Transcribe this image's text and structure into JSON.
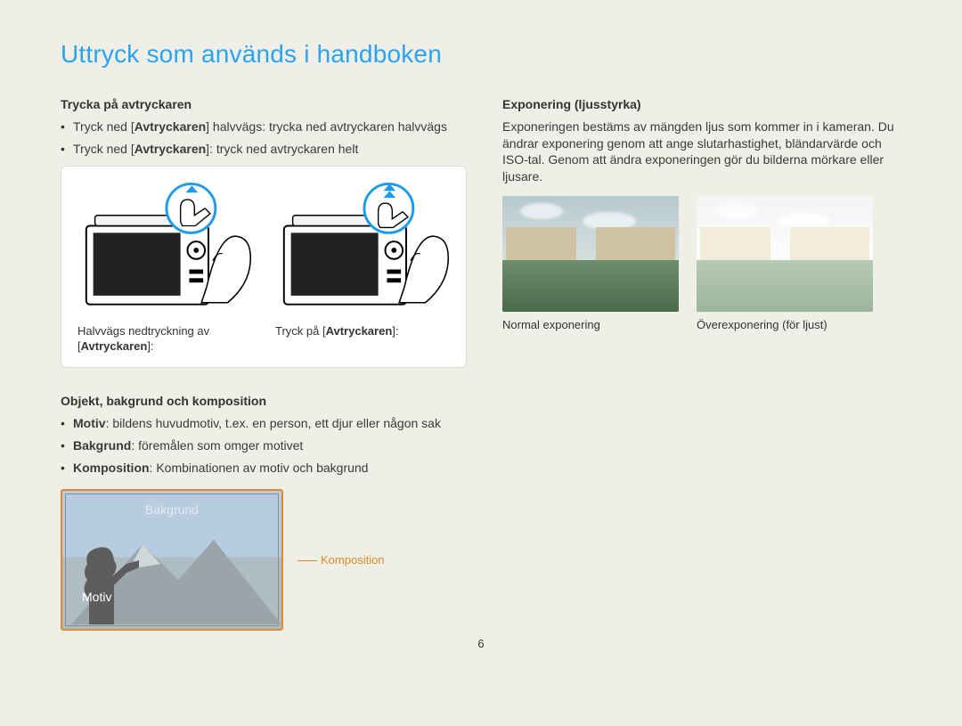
{
  "title": "Uttryck som används i handboken",
  "left": {
    "section1_heading": "Trycka på avtryckaren",
    "bullets1": [
      {
        "pre": "Tryck ned [",
        "strong": "Avtryckaren",
        "post": "] halvvägs: trycka ned avtryckaren halvvägs"
      },
      {
        "pre": "Tryck ned [",
        "strong": "Avtryckaren",
        "post": "]: tryck ned avtryckaren helt"
      }
    ],
    "fig_captions": {
      "left_pre": "Halvvägs nedtryckning av [",
      "left_strong": "Avtryckaren",
      "left_post": "]:",
      "right_pre": "Tryck på [",
      "right_strong": "Avtryckaren",
      "right_post": "]:"
    },
    "section2_heading": "Objekt, bakgrund och komposition",
    "bullets2": [
      {
        "strong": "Motiv",
        "post": ": bildens huvudmotiv, t.ex. en person, ett djur eller någon sak"
      },
      {
        "strong": "Bakgrund",
        "post": ": föremålen som omger motivet"
      },
      {
        "strong": "Komposition",
        "post": ": Kombinationen av motiv och bakgrund"
      }
    ],
    "comp_labels": {
      "bakgrund": "Bakgrund",
      "motiv": "Motiv",
      "komposition": "Komposition"
    }
  },
  "right": {
    "section_heading": "Exponering (ljusstyrka)",
    "paragraph": "Exponeringen bestäms av mängden ljus som kommer in i kameran. Du ändrar exponering genom att ange slutarhastighet, bländarvärde och ISO-tal. Genom att ändra exponeringen gör du bilderna mörkare eller ljusare.",
    "photo_captions": {
      "normal": "Normal exponering",
      "over": "Överexponering (för ljust)"
    }
  },
  "page_number": "6"
}
